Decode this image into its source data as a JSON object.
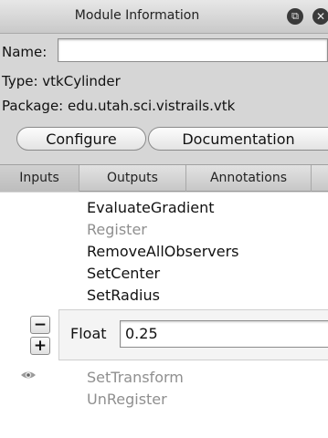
{
  "window": {
    "title": "Module Information",
    "float_icon": "float-window-icon",
    "close_icon": "close-icon"
  },
  "info": {
    "name_label": "Name:",
    "name_value": "",
    "type_line": "Type: vtkCylinder",
    "package_line": "Package: edu.utah.sci.vistrails.vtk"
  },
  "buttons": {
    "configure": "Configure",
    "documentation": "Documentation"
  },
  "tabs": [
    {
      "label": "Inputs",
      "selected": true
    },
    {
      "label": "Outputs",
      "selected": false
    },
    {
      "label": "Annotations",
      "selected": false
    }
  ],
  "ports": {
    "above": [
      {
        "label": "EvaluateGradient",
        "enabled": true
      },
      {
        "label": "Register",
        "enabled": false
      },
      {
        "label": "RemoveAllObservers",
        "enabled": true
      },
      {
        "label": "SetCenter",
        "enabled": true
      },
      {
        "label": "SetRadius",
        "enabled": true
      }
    ],
    "below": [
      {
        "label": "SetTransform",
        "enabled": false
      },
      {
        "label": "UnRegister",
        "enabled": false
      }
    ]
  },
  "parameter": {
    "remove_label": "−",
    "add_label": "+",
    "type_label": "Float",
    "value": "0.25"
  },
  "icons": {
    "visibility": "eye-icon"
  },
  "colors": {
    "enabled_text": "#111111",
    "disabled_text": "#8f8f8f",
    "list_background": "#ffffff"
  }
}
